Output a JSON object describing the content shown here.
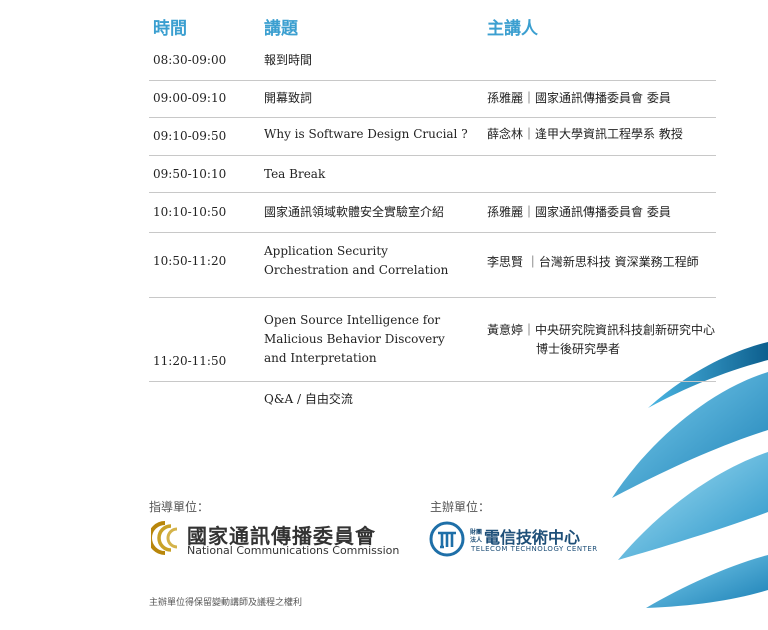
{
  "headers": {
    "time": "時間",
    "topic": "講題",
    "speaker": "主講人"
  },
  "rows": [
    {
      "time": "08:30-09:00",
      "topic": "報到時間",
      "speaker": ""
    },
    {
      "time": "09:00-09:10",
      "topic": "開幕致詞",
      "speaker": "孫雅麗｜國家通訊傳播委員會 委員"
    },
    {
      "time": "09:10-09:50",
      "topic": "Why is Software Design Crucial ?",
      "speaker": "薛念林｜逢甲大學資訊工程學系 教授"
    },
    {
      "time": "09:50-10:10",
      "topic": "Tea Break",
      "speaker": ""
    },
    {
      "time": "10:10-10:50",
      "topic": "國家通訊領域軟體安全實驗室介紹",
      "speaker": "孫雅麗｜國家通訊傳播委員會 委員"
    },
    {
      "time": "10:50-11:20",
      "topic_lines": [
        "Application Security",
        "Orchestration and Correlation"
      ],
      "speaker": "李思賢 ｜台灣新思科技 資深業務工程師"
    },
    {
      "time": "11:20-11:50",
      "topic_lines": [
        "Open Source Intelligence for",
        "Malicious Behavior Discovery",
        "and Interpretation"
      ],
      "speaker_lines": [
        "黃意婷｜中央研究院資訊科技創新研究中心",
        "博士後研究學者"
      ]
    },
    {
      "time": "",
      "topic": "Q&A / 自由交流",
      "speaker": ""
    }
  ],
  "organizers": {
    "guidance_label": "指導單位：",
    "guidance_name_zh": "國家通訊傳播委員會",
    "guidance_name_en": "National Communications Commission",
    "host_label": "主辦單位：",
    "host_small_top": "財團",
    "host_small_bottom": "法人",
    "host_name_zh": "電信技術中心",
    "host_name_en": "TELECOM TECHNOLOGY CENTER"
  },
  "footnote": "主辦單位得保留變動講師及議程之權利",
  "colors": {
    "header": "#3b9fd0",
    "accent_blue": "#1e7fb0",
    "ncc_gold": "#b8860b"
  },
  "icons": [
    "ncc-logo-icon",
    "ttc-logo-icon",
    "blue-ribbon-decoration"
  ]
}
